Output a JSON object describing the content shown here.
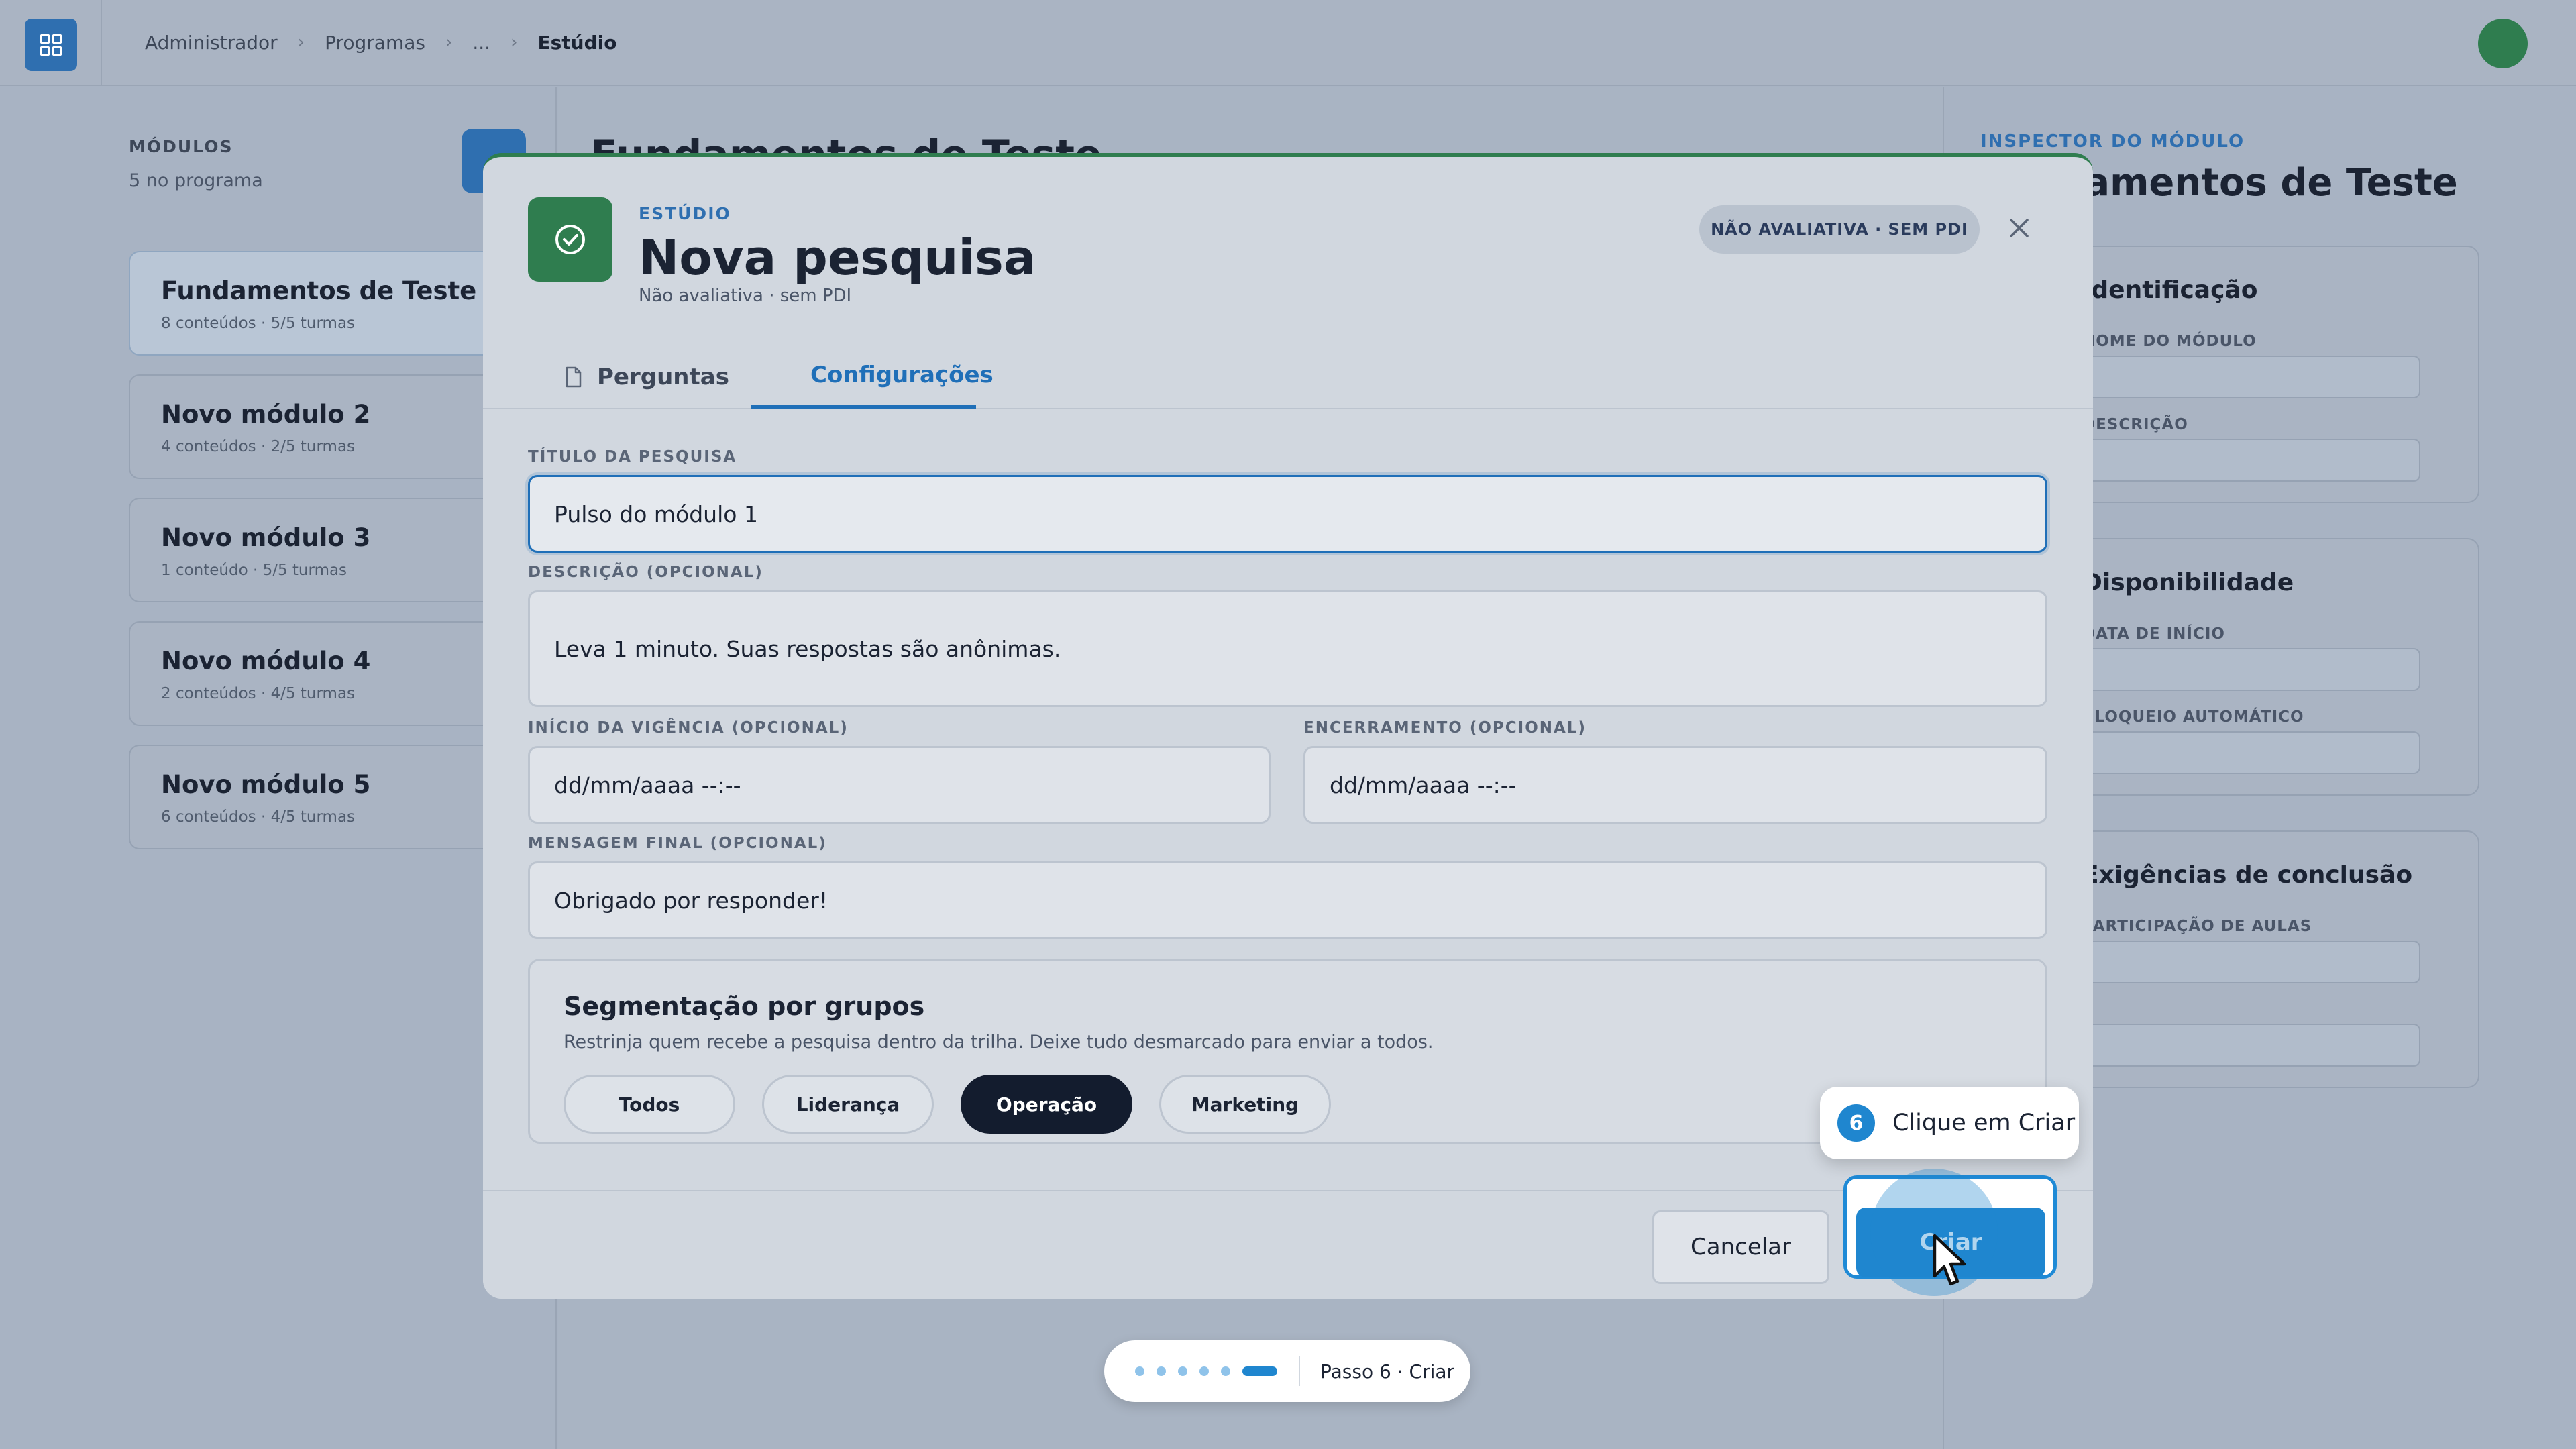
{
  "topbar": {
    "breadcrumbs": [
      "Administrador",
      "Programas",
      "...",
      "Estúdio"
    ]
  },
  "sidebar": {
    "title": "MÓDULOS",
    "subtitle": "5 no programa",
    "modules": [
      {
        "name": "Fundamentos de Teste",
        "meta": "8 conteúdos · 5/5 turmas"
      },
      {
        "name": "Novo módulo 2",
        "meta": "4 conteúdos · 2/5 turmas"
      },
      {
        "name": "Novo módulo 3",
        "meta": "1 conteúdo · 5/5 turmas"
      },
      {
        "name": "Novo módulo 4",
        "meta": "2 conteúdos · 4/5 turmas"
      },
      {
        "name": "Novo módulo 5",
        "meta": "6 conteúdos · 4/5 turmas"
      }
    ]
  },
  "center": {
    "title": "Fundamentos de Teste"
  },
  "inspector": {
    "label": "INSPECTOR DO MÓDULO",
    "title": "Fundamentos de Teste",
    "sections": [
      {
        "title": "Identificação",
        "fields": [
          "NOME DO MÓDULO",
          "DESCRIÇÃO"
        ]
      },
      {
        "title": "Disponibilidade",
        "fields": [
          "DATA DE INÍCIO",
          "BLOQUEIO AUTOMÁTICO"
        ]
      },
      {
        "title": "Exigências de conclusão",
        "fields": [
          "PARTICIPAÇÃO DE AULAS"
        ]
      }
    ]
  },
  "modal": {
    "eyebrow": "ESTÚDIO",
    "title": "Nova pesquisa",
    "subtitle": "Não avaliativa · sem PDI",
    "badge": "NÃO AVALIATIVA · SEM PDI",
    "tabs": [
      {
        "label": "Perguntas",
        "icon": "document-icon"
      },
      {
        "label": "Configurações",
        "icon": "shield-icon"
      }
    ],
    "form": {
      "title_label": "TÍTULO DA PESQUISA",
      "title_value": "Pulso do módulo 1",
      "description_label": "DESCRIÇÃO (OPCIONAL)",
      "description_value": "Leva 1 minuto. Suas respostas são anônimas.",
      "start_label": "INÍCIO DA VIGÊNCIA (OPCIONAL)",
      "start_value": "dd/mm/aaaa --:--",
      "end_label": "ENCERRAMENTO (OPCIONAL)",
      "end_value": "dd/mm/aaaa --:--",
      "final_msg_label": "MENSAGEM FINAL (OPCIONAL)",
      "final_msg_value": "Obrigado por responder!"
    },
    "segmentation": {
      "title": "Segmentação por grupos",
      "description": "Restrinja quem recebe a pesquisa dentro da trilha. Deixe tudo desmarcado para enviar a todos.",
      "groups": [
        {
          "label": "Todos",
          "selected": false
        },
        {
          "label": "Liderança",
          "selected": false
        },
        {
          "label": "Operação",
          "selected": true
        },
        {
          "label": "Marketing",
          "selected": false
        }
      ]
    },
    "footer": {
      "cancel_label": "Cancelar",
      "create_label": "Criar"
    }
  },
  "tutorial": {
    "step_number": "6",
    "tooltip": "Clique em Criar",
    "progress_label": "Passo 6 · Criar",
    "total_steps": 6,
    "current_step": 6
  },
  "colors": {
    "accent": "#1f86cf",
    "brand_green": "#2f7d4f",
    "selected_pill": "#131c2e"
  }
}
